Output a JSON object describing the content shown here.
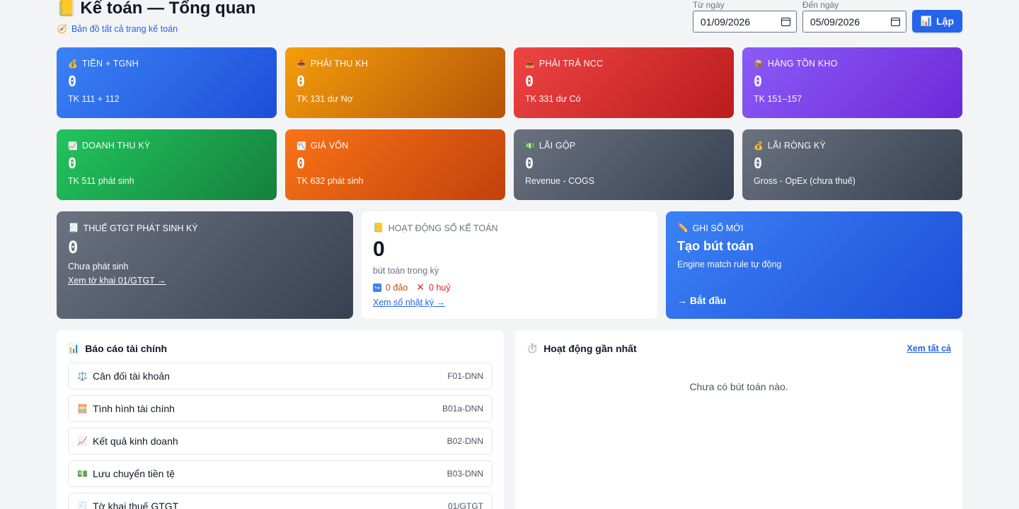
{
  "header": {
    "title_icon": "📒",
    "title": "Kế toán — Tổng quan",
    "map_icon": "🧭",
    "map_link": "Bản đồ tất cả trang kế toán",
    "from_label": "Từ ngày",
    "from_value": "01/09/2026",
    "to_label": "Đến ngày",
    "to_value": "05/09/2026",
    "button_icon": "📊",
    "button_label": "Lập"
  },
  "kpis": [
    {
      "icon": "💰",
      "label": "TIỀN + TGNH",
      "value": "0",
      "sub": "TK 111 + 112",
      "color": "#2563eb"
    },
    {
      "icon": "📥",
      "label": "PHẢI THU KH",
      "value": "0",
      "sub": "TK 131 dư Nợ",
      "color": "#d97706"
    },
    {
      "icon": "📤",
      "label": "PHẢI TRẢ NCC",
      "value": "0",
      "sub": "TK 331 dư Có",
      "color": "#dc2626"
    },
    {
      "icon": "📦",
      "label": "HÀNG TỒN KHO",
      "value": "0",
      "sub": "TK 151–157",
      "color": "#7c3aed"
    },
    {
      "icon": "📈",
      "label": "DOANH THU KỲ",
      "value": "0",
      "sub": "TK 511 phát sinh",
      "color": "#16a34a"
    },
    {
      "icon": "📉",
      "label": "GIÁ VỐN",
      "value": "0",
      "sub": "TK 632 phát sinh",
      "color": "#ea580c"
    },
    {
      "icon": "💵",
      "label": "LÃI GỘP",
      "value": "0",
      "sub": "Revenue - COGS",
      "color": "#4b5563"
    },
    {
      "icon": "💰",
      "label": "LÃI RÒNG KỲ",
      "value": "0",
      "sub": "Gross - OpEx (chưa thuế)",
      "color": "#4b5563"
    }
  ],
  "vat": {
    "icon": "🧾",
    "label": "THUẾ GTGT PHÁT SINH KỲ",
    "value": "0",
    "sub": "Chưa phát sinh",
    "link": "Xem tờ khai 01/GTGT →"
  },
  "activity": {
    "icon": "📒",
    "label": "HOẠT ĐỘNG SỔ KẾ TOÁN",
    "count": "0",
    "sub": "bút toán trong kỳ",
    "reversed": "0 đảo",
    "cancelled": "0 huỷ",
    "link": "Xem sổ nhật ký →"
  },
  "new_entry": {
    "icon": "✏️",
    "label": "GHI SỔ MỚI",
    "title": "Tạo bút toán",
    "sub": "Engine match rule tự động",
    "start": "→ Bắt đầu"
  },
  "reports": {
    "icon": "📊",
    "title": "Báo cáo tài chính",
    "items": [
      {
        "icon": "⚖️",
        "label": "Cân đối tài khoản",
        "code": "F01-DNN"
      },
      {
        "icon": "🧮",
        "label": "Tình hình tài chính",
        "code": "B01a-DNN"
      },
      {
        "icon": "📈",
        "label": "Kết quả kinh doanh",
        "code": "B02-DNN"
      },
      {
        "icon": "💵",
        "label": "Lưu chuyển tiền tệ",
        "code": "B03-DNN"
      },
      {
        "icon": "🧾",
        "label": "Tờ khai thuế GTGT",
        "code": "01/GTGT"
      }
    ]
  },
  "recent": {
    "icon": "⏱️",
    "title": "Hoạt động gần nhất",
    "see_all": "Xem tất cả",
    "empty": "Chưa có bút toán nào."
  }
}
